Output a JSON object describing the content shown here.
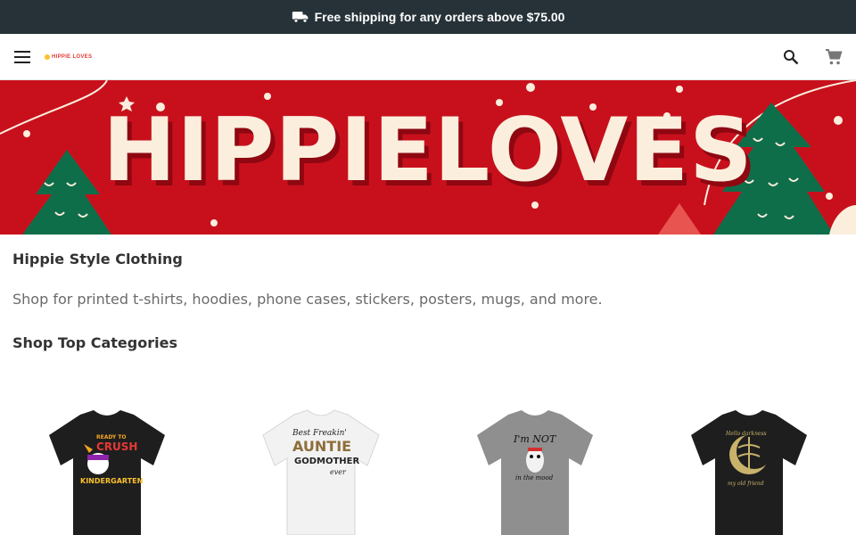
{
  "promo": {
    "icon": "truck-icon",
    "text": "Free shipping for any orders above $75.00"
  },
  "header": {
    "menu_icon": "menu-icon",
    "logo_text": "HIPPIE LOVES",
    "search_icon": "search-icon",
    "cart_icon": "cart-icon"
  },
  "hero": {
    "title": "HIPPIELOVES",
    "colors": {
      "background": "#c8101c",
      "text": "#fbeedd",
      "tree": "#0f6e4a"
    }
  },
  "main": {
    "heading": "Hippie Style Clothing",
    "tagline": "Shop for printed t-shirts, hoodies, phone cases, stickers, posters, mugs, and more.",
    "categories_heading": "Shop Top Categories"
  },
  "products": [
    {
      "shirt_color": "#1e1e1e",
      "print_text": [
        "READY TO",
        "CRUSH",
        "KINDERGARTEN"
      ]
    },
    {
      "shirt_color": "#f2f2f2",
      "print_text": [
        "Best Freakin'",
        "AUNTIE",
        "GODMOTHER",
        "ever"
      ]
    },
    {
      "shirt_color": "#8f8f8f",
      "print_text": [
        "I'm NOT",
        "in the mood"
      ]
    },
    {
      "shirt_color": "#1e1e1e",
      "print_text": [
        "Hello darkness",
        "my old friend"
      ]
    }
  ]
}
